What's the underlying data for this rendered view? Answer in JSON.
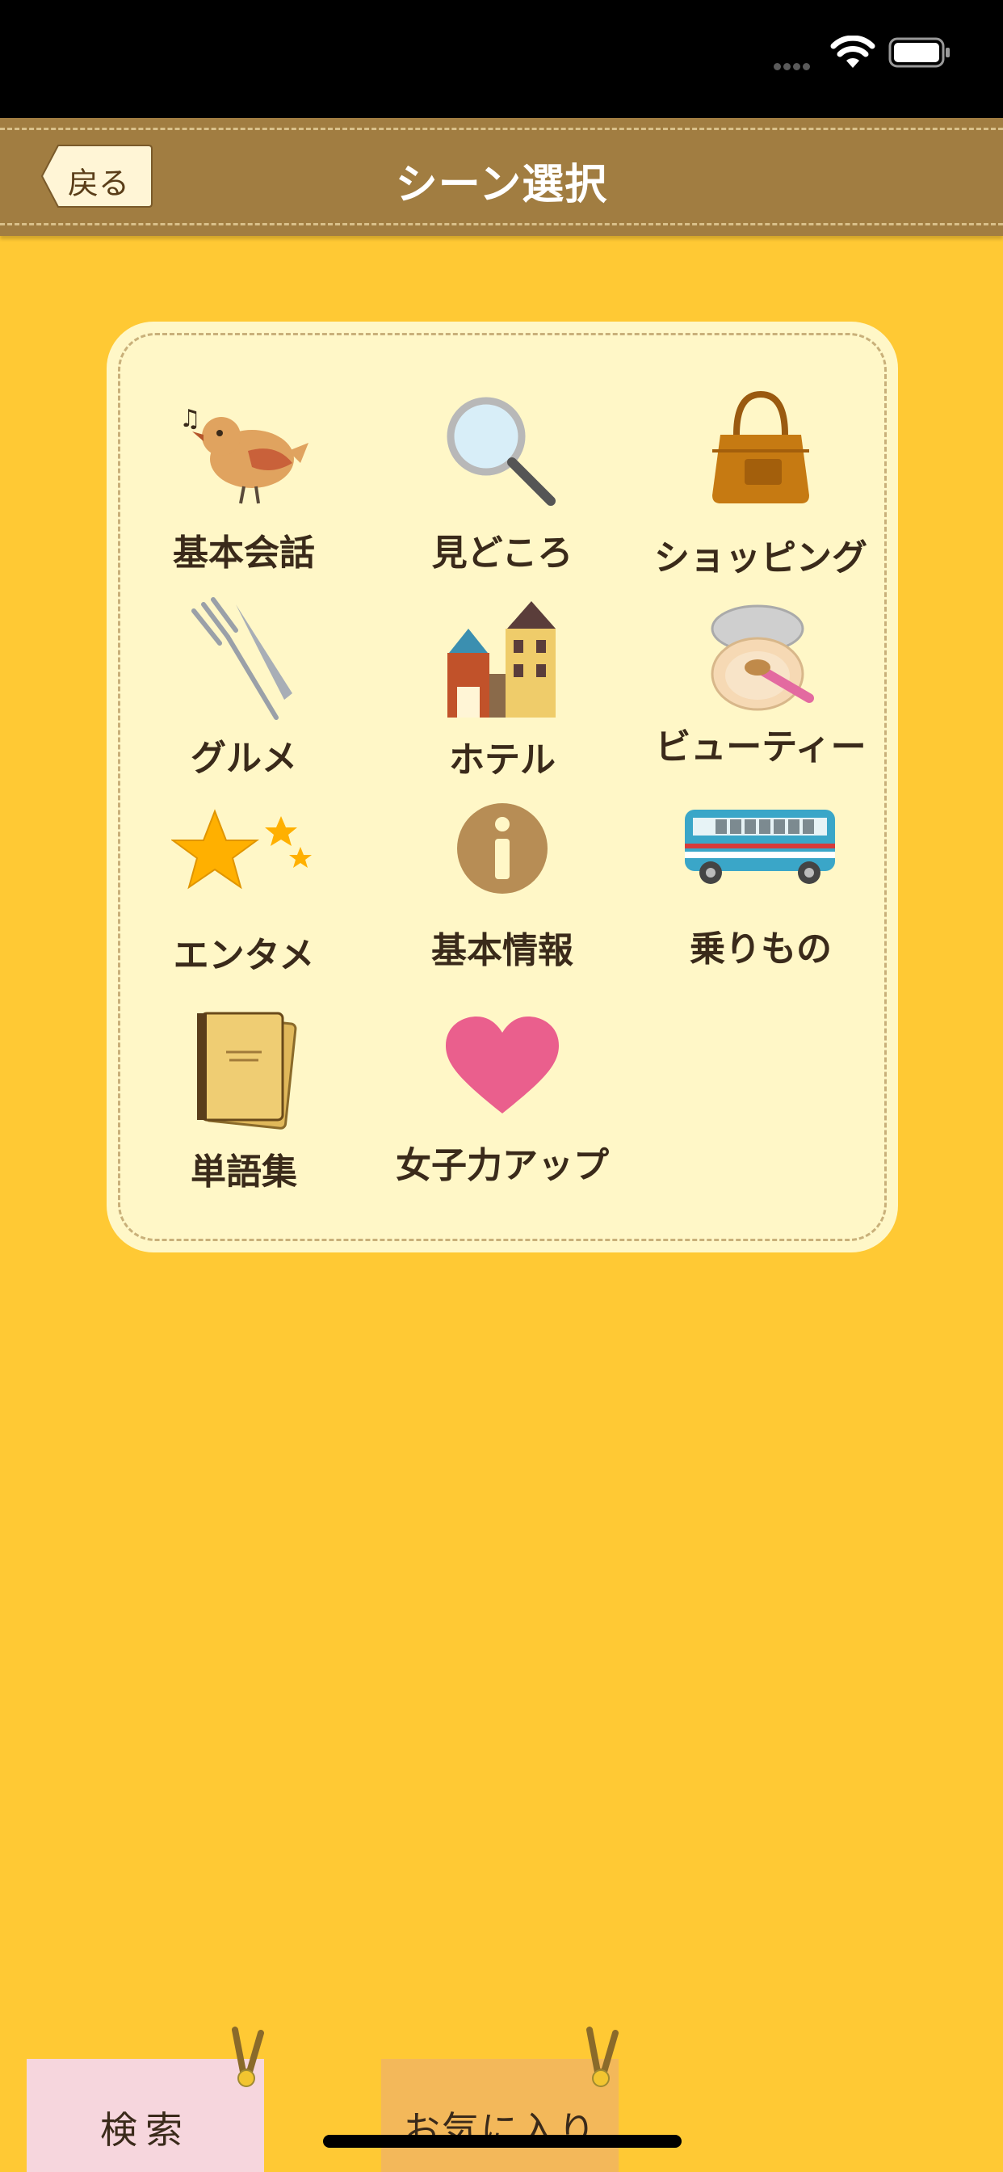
{
  "nav": {
    "title": "シーン選択",
    "back_label": "戻る"
  },
  "scenes": [
    {
      "label": "基本会話",
      "icon": "bird-icon"
    },
    {
      "label": "見どころ",
      "icon": "magnifier-icon"
    },
    {
      "label": "ショッピング",
      "icon": "handbag-icon"
    },
    {
      "label": "グルメ",
      "icon": "fork-knife-icon"
    },
    {
      "label": "ホテル",
      "icon": "buildings-icon"
    },
    {
      "label": "ビューティー",
      "icon": "compact-icon"
    },
    {
      "label": "エンタメ",
      "icon": "stars-icon"
    },
    {
      "label": "基本情報",
      "icon": "info-icon"
    },
    {
      "label": "乗りもの",
      "icon": "bus-icon"
    },
    {
      "label": "単語集",
      "icon": "notebook-icon"
    },
    {
      "label": "女子力アップ",
      "icon": "heart-icon"
    }
  ],
  "tabs": {
    "search_label": "検索",
    "favorites_label": "お気に入り"
  },
  "colors": {
    "background": "#ffc934",
    "nav_bar": "#a17d41",
    "card": "#fff7c7",
    "search_tab": "#f6d6dd",
    "favorites_tab": "#f3b85a"
  }
}
